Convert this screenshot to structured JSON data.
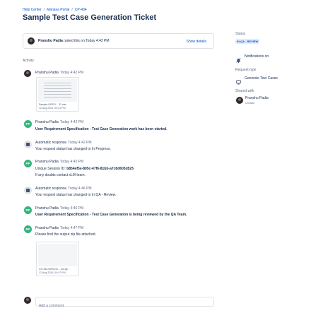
{
  "breadcrumb": {
    "items": [
      "Help Center",
      "Manava Portal",
      "CP-434"
    ]
  },
  "ticket": {
    "title": "Sample Test Case Generation Ticket"
  },
  "raised": {
    "user": "Pranshu Padia",
    "text": "raised this on Today 4:42 PM",
    "show_details": "Show details"
  },
  "activity": {
    "heading": "Activity",
    "entries": [
      {
        "author": "Pranshu Padia",
        "time": "Today 4:42 PM",
        "file": {
          "name": "Sample-URS.0... 31.xlsx",
          "date": "12 Aug 2024, 04:41 PM"
        }
      },
      {
        "author": "Pranshu Padia",
        "time": "Today 4:42 PM",
        "text": "User Requirement Specification - Test Case Generation work has been started."
      },
      {
        "author": "Automatic response",
        "time": "Today 4:42 PM",
        "text": "Your request status has changed to In Progress."
      },
      {
        "author": "Pranshu Padia",
        "time": "Today 4:42 PM",
        "line1_prefix": "Unique Session ID:",
        "line1_value": "b854ef5e-805c-47f6-81bb-a7c8d605d525",
        "line2": "If any doubts contact xLM team."
      },
      {
        "author": "Automatic response",
        "time": "Today 4:46 PM",
        "text": "Your request status has changed to In QA - Review."
      },
      {
        "author": "Pranshu Padia",
        "time": "Today 4:46 PM",
        "text": "User Requirement Specification -  Test Case Generation is being reviewed by the QA Team."
      },
      {
        "author": "Pranshu Padia",
        "time": "Today 4:47 PM",
        "text": "Please find the output zip file attached.",
        "file": {
          "name": "CP-434-URS-Ge... ion.zip",
          "date": "12 Aug 2024, 04:47 PM"
        }
      }
    ],
    "avatar_initials": "PP"
  },
  "comment": {
    "placeholder": "Add a comment"
  },
  "sidebar": {
    "status_label": "Status",
    "status_value": "IN QA - REVIEW",
    "notifications_label": "Notifications on",
    "request_type_label": "Request type",
    "request_type_value": "Generate Test Cases",
    "shared_with_label": "Shared with",
    "shared_user": "Pranshu Padia",
    "shared_role": "Creator"
  },
  "colors": {
    "accent": "#0052cc",
    "success": "#36b37e",
    "status_bg": "#deebff"
  },
  "icons": [
    "avatar",
    "bot-icon",
    "bell-icon",
    "request-type-icon",
    "file-thumbnail"
  ]
}
